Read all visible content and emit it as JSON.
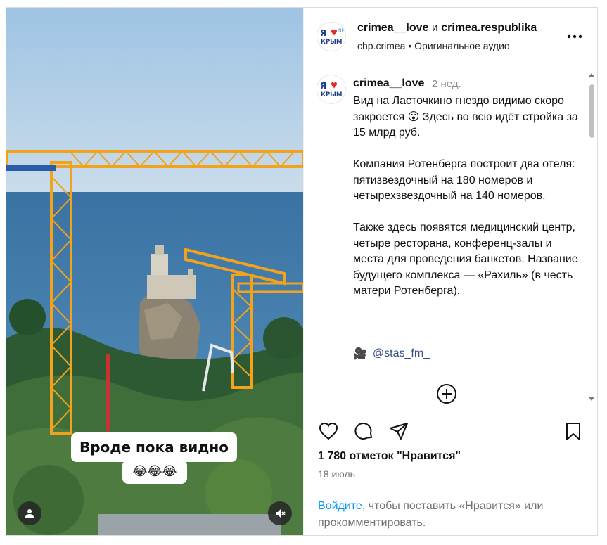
{
  "post": {
    "overlay_caption": "Вроде пока видно",
    "overlay_emoji": "😂😂😂",
    "header": {
      "author": "crimea__love",
      "conjunction": "и",
      "coauthor": "crimea.respublika",
      "subtitle": "chp.crimea • Оригинальное аудио",
      "avatar_logo_text": "Я ❤ КРЫМ"
    },
    "caption": {
      "username": "crimea__love",
      "time": "2 нед.",
      "paragraphs": [
        "Вид на Ласточкино гнездо видимо скоро закроется 😮 Здесь во всю идёт стройка за 15 млрд руб.",
        "Компания Ротенберга построит два отеля: пятизвездочный на 180 номеров и четырехзвездочный на 140 номеров.",
        "Также здесь появятся медицинский центр, четыре ресторана, конференц-залы и места для проведения банкетов. Название будущего комплекса  — «Рахиль» (в честь матери Ротенберга)."
      ],
      "mention_emoji": "🎥",
      "mention": "@stas_fm_"
    },
    "likes": "1 780 отметок \"Нравится\"",
    "date": "18 июль",
    "login_link": "Войдите",
    "login_rest": ", чтобы поставить «Нравится» или прокомментировать."
  },
  "icons": {
    "more": "more-horizontal-icon",
    "like": "heart-icon",
    "comment": "comment-bubble-icon",
    "share": "paper-plane-icon",
    "save": "bookmark-icon",
    "load_more": "plus-circle-icon",
    "user_tag": "user-icon",
    "mute": "speaker-muted-icon"
  },
  "colors": {
    "link": "#0095f6",
    "mention": "#385185",
    "secondary_text": "#737373",
    "border": "#dbdbdb",
    "crane": "#f2a31b",
    "sea": "#3e78a8"
  }
}
